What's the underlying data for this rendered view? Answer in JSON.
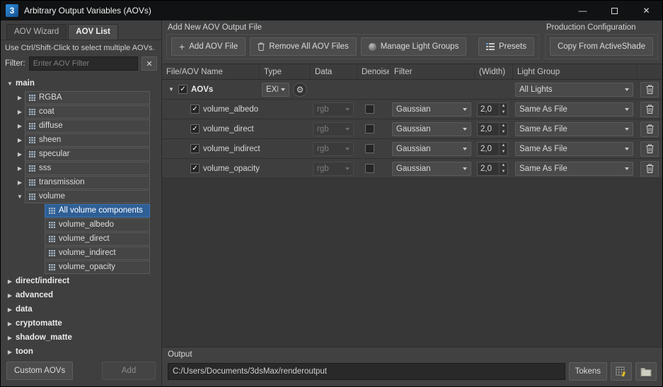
{
  "window": {
    "title": "Arbitrary Output Variables (AOVs)",
    "app_icon_glyph": "3",
    "controls": {
      "minimize": "—",
      "close": "✕"
    }
  },
  "left_panel": {
    "tabs": [
      {
        "label": "AOV Wizard"
      },
      {
        "label": "AOV List"
      }
    ],
    "hint": "Use Ctrl/Shift-Click to select multiple AOVs.",
    "filter": {
      "label": "Filter:",
      "placeholder": "Enter AOV Filter",
      "clear_icon": "✕"
    },
    "tree_items": [
      {
        "label": "main",
        "level": 0,
        "arrow": "down",
        "boxed": false,
        "bold": true,
        "selected": false
      },
      {
        "label": "RGBA",
        "level": 1,
        "arrow": "right",
        "boxed": true,
        "bold": false,
        "selected": false
      },
      {
        "label": "coat",
        "level": 1,
        "arrow": "right",
        "boxed": true,
        "bold": false,
        "selected": false
      },
      {
        "label": "diffuse",
        "level": 1,
        "arrow": "right",
        "boxed": true,
        "bold": false,
        "selected": false
      },
      {
        "label": "sheen",
        "level": 1,
        "arrow": "right",
        "boxed": true,
        "bold": false,
        "selected": false
      },
      {
        "label": "specular",
        "level": 1,
        "arrow": "right",
        "boxed": true,
        "bold": false,
        "selected": false
      },
      {
        "label": "sss",
        "level": 1,
        "arrow": "right",
        "boxed": true,
        "bold": false,
        "selected": false
      },
      {
        "label": "transmission",
        "level": 1,
        "arrow": "right",
        "boxed": true,
        "bold": false,
        "selected": false
      },
      {
        "label": "volume",
        "level": 1,
        "arrow": "down",
        "boxed": true,
        "bold": false,
        "selected": false
      },
      {
        "label": "All volume components",
        "level": 2,
        "arrow": "none",
        "boxed": true,
        "bold": false,
        "selected": true
      },
      {
        "label": "volume_albedo",
        "level": 2,
        "arrow": "none",
        "boxed": true,
        "bold": false,
        "selected": false
      },
      {
        "label": "volume_direct",
        "level": 2,
        "arrow": "none",
        "boxed": true,
        "bold": false,
        "selected": false
      },
      {
        "label": "volume_indirect",
        "level": 2,
        "arrow": "none",
        "boxed": true,
        "bold": false,
        "selected": false
      },
      {
        "label": "volume_opacity",
        "level": 2,
        "arrow": "none",
        "boxed": true,
        "bold": false,
        "selected": false
      },
      {
        "label": "direct/indirect",
        "level": 0,
        "arrow": "right",
        "boxed": false,
        "bold": true,
        "selected": false
      },
      {
        "label": "advanced",
        "level": 0,
        "arrow": "right",
        "boxed": false,
        "bold": true,
        "selected": false
      },
      {
        "label": "data",
        "level": 0,
        "arrow": "right",
        "boxed": false,
        "bold": true,
        "selected": false
      },
      {
        "label": "cryptomatte",
        "level": 0,
        "arrow": "right",
        "boxed": false,
        "bold": true,
        "selected": false
      },
      {
        "label": "shadow_matte",
        "level": 0,
        "arrow": "right",
        "boxed": false,
        "bold": true,
        "selected": false
      },
      {
        "label": "toon",
        "level": 0,
        "arrow": "right",
        "boxed": false,
        "bold": true,
        "selected": false
      }
    ],
    "footer": {
      "custom_aovs_button": "Custom AOVs",
      "add_button": "Add"
    }
  },
  "toolbar": {
    "group_label": "Add New AOV Output File",
    "add_aov_file_button": "Add AOV File",
    "remove_all_button": "Remove All AOV Files",
    "manage_light_groups_button": "Manage Light Groups",
    "presets_button": "Presets",
    "production": {
      "label": "Production Configuration",
      "copy_button": "Copy From ActiveShade"
    }
  },
  "table": {
    "columns": [
      "File/AOV Name",
      "Type",
      "Data",
      "Denoise",
      "Filter",
      "(Width)",
      "Light Group"
    ],
    "file_row": {
      "name": "AOVs",
      "type": "EXR",
      "light_group": "All Lights",
      "checked": true
    },
    "aov_rows": [
      {
        "name": "volume_albedo",
        "checked": true,
        "data": "rgb",
        "denoise": false,
        "filter": "Gaussian",
        "width": "2,0",
        "light_group": "Same As File"
      },
      {
        "name": "volume_direct",
        "checked": true,
        "data": "rgb",
        "denoise": false,
        "filter": "Gaussian",
        "width": "2,0",
        "light_group": "Same As File"
      },
      {
        "name": "volume_indirect",
        "checked": true,
        "data": "rgb",
        "denoise": false,
        "filter": "Gaussian",
        "width": "2,0",
        "light_group": "Same As File"
      },
      {
        "name": "volume_opacity",
        "checked": true,
        "data": "rgb",
        "denoise": false,
        "filter": "Gaussian",
        "width": "2,0",
        "light_group": "Same As File"
      }
    ]
  },
  "output": {
    "label": "Output",
    "path": "C:/Users/Documents/3dsMax/renderoutput",
    "tokens_button": "Tokens"
  }
}
